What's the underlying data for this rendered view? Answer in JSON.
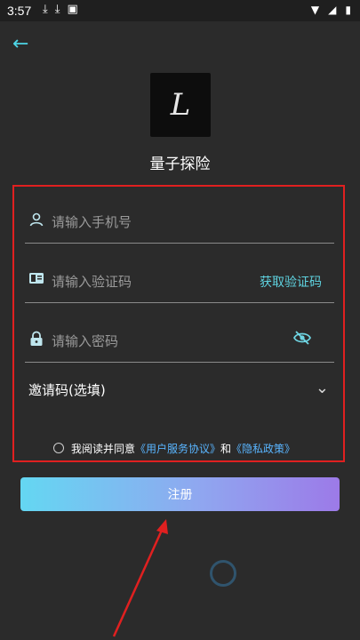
{
  "status_bar": {
    "time": "3:57",
    "left_icons": [
      "download-icon",
      "download-icon",
      "image-icon"
    ],
    "right_icons": [
      "wifi-icon",
      "signal-icon",
      "battery-icon"
    ]
  },
  "app": {
    "name": "量子探险",
    "logo_letter": "L"
  },
  "form": {
    "phone_placeholder": "请输入手机号",
    "code_placeholder": "请输入验证码",
    "get_code_label": "获取验证码",
    "password_placeholder": "请输入密码",
    "invite_label": "邀请码(选填)"
  },
  "agreement": {
    "prefix": "我阅读并同意",
    "user_agreement": "《用户服务协议》",
    "conjunction": "和",
    "privacy_policy": "《隐私政策》"
  },
  "register_label": "注册",
  "colors": {
    "accent": "#4dd5e6",
    "link": "#59b5ff",
    "highlight_border": "#e02020",
    "button_gradient_start": "#64d7f2",
    "button_gradient_end": "#9c7ae8"
  }
}
